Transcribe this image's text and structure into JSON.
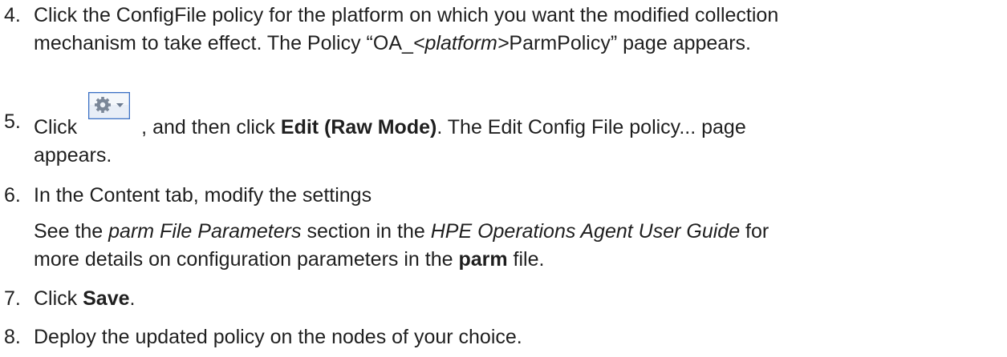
{
  "steps": [
    {
      "number": "4.",
      "text_1": "Click the ConfigFile policy for the platform on which you want the modified collection",
      "text_2a": "mechanism to take effect. The Policy “OA_",
      "text_2_em": "<platform>",
      "text_2b": "ParmPolicy” page appears."
    },
    {
      "number": "5.",
      "text_a": "Click",
      "text_b": ", and then click ",
      "text_bold": "Edit (Raw Mode)",
      "text_c": ". The Edit Config File policy... page",
      "text_2": "appears.",
      "icon": "gear-dropdown-icon"
    },
    {
      "number": "6.",
      "text_1": "In the Content tab, modify the settings",
      "text_2a": "See the ",
      "text_2_em1": "parm File Parameters",
      "text_2b": " section in the ",
      "text_2_em2": "HPE Operations Agent User Guide",
      "text_2c": " for",
      "text_3a": "more details on configuration parameters in the ",
      "text_3_bold": "parm",
      "text_3b": " file."
    },
    {
      "number": "7.",
      "text_a": "Click ",
      "text_bold": "Save",
      "text_b": "."
    },
    {
      "number": "8.",
      "text_1": "Deploy the updated policy on the nodes of your choice."
    }
  ],
  "colors": {
    "text": "#1f1f1f",
    "icon_border": "#3a6fc4",
    "icon_fill": "#e8eef7",
    "gear": "#6b7a8f"
  }
}
